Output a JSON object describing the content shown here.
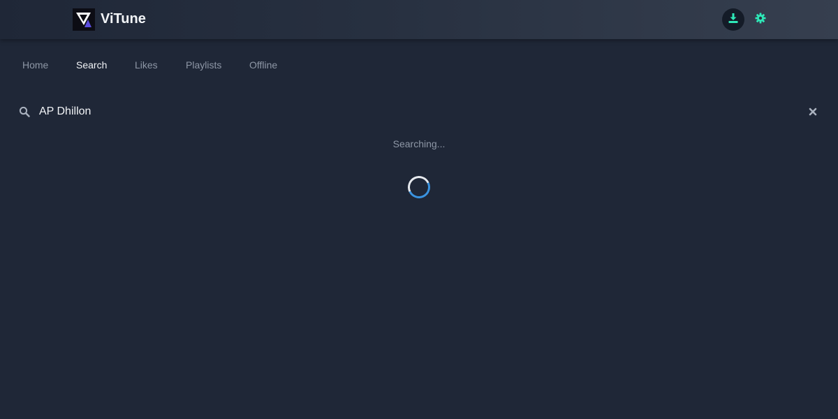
{
  "app": {
    "title": "ViTune",
    "logo_icon": "vitune-logo-icon"
  },
  "header": {
    "download_icon": "download-icon",
    "settings_icon": "gear-icon",
    "accent_color": "#2ee8b8"
  },
  "nav": {
    "tabs": [
      {
        "label": "Home",
        "active": false
      },
      {
        "label": "Search",
        "active": true
      },
      {
        "label": "Likes",
        "active": false
      },
      {
        "label": "Playlists",
        "active": false
      },
      {
        "label": "Offline",
        "active": false
      }
    ]
  },
  "search": {
    "value": "AP Dhillon",
    "search_icon": "search-icon",
    "clear_icon": "close-icon"
  },
  "status": {
    "text": "Searching...",
    "loading": true
  },
  "colors": {
    "background": "#1f2737",
    "text_primary": "#f2f4f7",
    "text_muted": "#8e97a6",
    "spinner_accent": "#3a93e0"
  }
}
